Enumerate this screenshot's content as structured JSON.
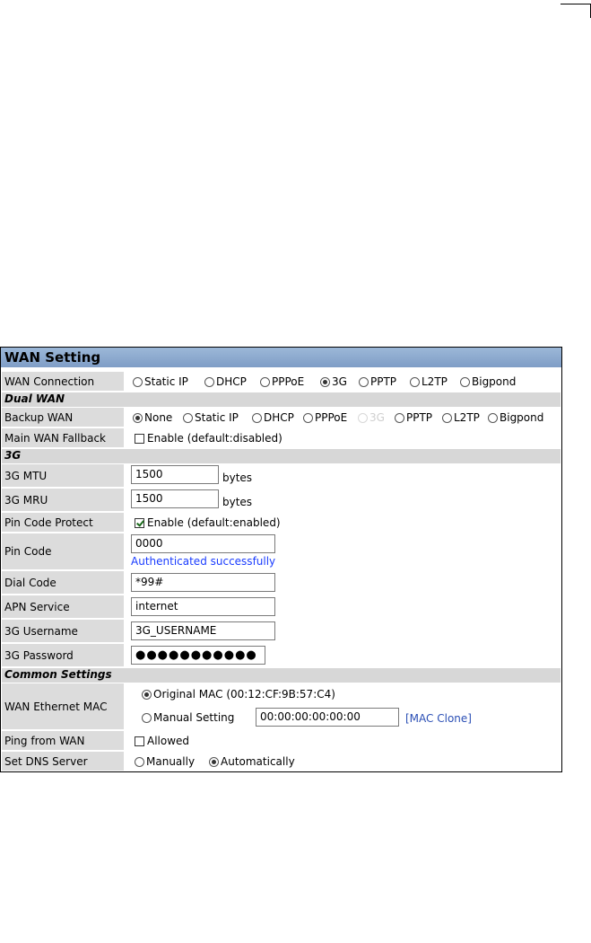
{
  "panel": {
    "title": "WAN Setting"
  },
  "wan_connection": {
    "label": "WAN Connection",
    "options": [
      "Static IP",
      "DHCP",
      "PPPoE",
      "3G",
      "PPTP",
      "L2TP",
      "Bigpond"
    ],
    "selected": "3G"
  },
  "dual_wan": {
    "section": "Dual WAN",
    "backup_label": "Backup WAN",
    "backup_options": [
      "None",
      "Static IP",
      "DHCP",
      "PPPoE",
      "3G",
      "PPTP",
      "L2TP",
      "Bigpond"
    ],
    "backup_selected": "None",
    "backup_disabled": "3G",
    "fallback_label": "Main WAN Fallback",
    "fallback_text": "Enable (default:disabled)",
    "fallback_checked": false
  },
  "g3": {
    "section": "3G",
    "mtu_label": "3G MTU",
    "mtu_value": "1500",
    "mtu_unit": "bytes",
    "mru_label": "3G MRU",
    "mru_value": "1500",
    "mru_unit": "bytes",
    "pin_protect_label": "Pin Code Protect",
    "pin_protect_text": "Enable (default:enabled)",
    "pin_protect_checked": true,
    "pin_label": "Pin Code",
    "pin_value": "0000",
    "pin_status": "Authenticated successfully",
    "dial_label": "Dial Code",
    "dial_value": "*99#",
    "apn_label": "APN Service",
    "apn_value": "internet",
    "user_label": "3G Username",
    "user_value": "3G_USERNAME",
    "pass_label": "3G Password",
    "pass_value": "●●●●●●●●●●●"
  },
  "common": {
    "section": "Common Settings",
    "mac_label": "WAN Ethernet MAC",
    "mac_original": "Original MAC (00:12:CF:9B:57:C4)",
    "mac_manual": "Manual Setting",
    "mac_manual_value": "00:00:00:00:00:00",
    "mac_clone": "[MAC Clone]",
    "mac_selected": "original",
    "ping_label": "Ping from WAN",
    "ping_text": "Allowed",
    "ping_checked": false,
    "dns_label": "Set DNS Server",
    "dns_manual": "Manually",
    "dns_auto": "Automatically",
    "dns_selected": "auto"
  }
}
